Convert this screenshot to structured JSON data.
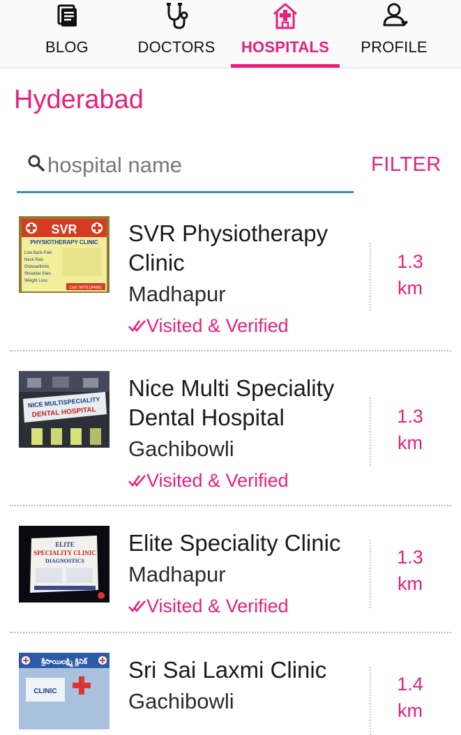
{
  "tabs": [
    {
      "label": "BLOG",
      "icon": "blog-icon",
      "active": false
    },
    {
      "label": "DOCTORS",
      "icon": "stethoscope-icon",
      "active": false
    },
    {
      "label": "HOSPITALS",
      "icon": "hospital-icon",
      "active": true
    },
    {
      "label": "PROFILE",
      "icon": "profile-icon",
      "active": false
    }
  ],
  "city": "Hyderabad",
  "search": {
    "placeholder": "hospital name",
    "value": ""
  },
  "filter_label": "FILTER",
  "colors": {
    "accent": "#e91e7b",
    "search_underline": "#3d8fb8"
  },
  "verified_icon": "double-check-icon",
  "clinics": [
    {
      "name": "SVR Physiotherapy Clinic",
      "area": "Madhapur",
      "verified": "Visited & Verified",
      "dist_value": "1.3",
      "dist_unit": "km",
      "thumb_text": [
        "SVR",
        "PHYSIOTHERAPY CLINIC",
        "Low Back Pain",
        "Neck Pain",
        "Osteoarthritis",
        "Shoulder Pain",
        "Weight Loss",
        "Cell: 9676194681"
      ]
    },
    {
      "name": "Nice Multi Speciality Dental Hospital",
      "area": "Gachibowli",
      "verified": "Visited & Verified",
      "dist_value": "1.3",
      "dist_unit": "km",
      "thumb_text": [
        "NICE MULTISPECIALITY",
        "DENTAL HOSPITAL"
      ]
    },
    {
      "name": "Elite Speciality Clinic",
      "area": "Madhapur",
      "verified": "Visited & Verified",
      "dist_value": "1.3",
      "dist_unit": "km",
      "thumb_text": [
        "ELITE",
        "SPECIALITY CLINIC",
        "DIAGNOSTICS"
      ]
    },
    {
      "name": "Sri Sai Laxmi Clinic",
      "area": "Gachibowli",
      "verified": "",
      "dist_value": "1.4",
      "dist_unit": "km",
      "thumb_text": [
        "శ్రీసాయిలక్ష్మి క్లినిక్",
        "CLINIC"
      ]
    }
  ]
}
